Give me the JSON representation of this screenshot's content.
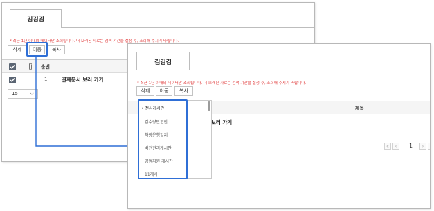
{
  "back_window": {
    "tab_label": "김김김",
    "notice": "* 최근 1년 이내의 데이터만 조회됩니다. 더 오래된 자료는 검색 기간을 설정 후, 조회해 주시기 바랍니다.",
    "buttons": {
      "delete": "삭제",
      "move": "이동",
      "copy": "복사"
    },
    "table": {
      "header_seq": "순번",
      "rows": [
        {
          "seq": "1",
          "title": "결재문서 보러 가기"
        }
      ]
    },
    "page_size": "15"
  },
  "front_window": {
    "tab_label": "김김김",
    "notice": "* 최근 1년 이내의 데이터만 조회됩니다. 더 오래된 자료는 검색 기간을 설정 후, 조회해 주시기 바랍니다.",
    "buttons": {
      "delete": "삭제",
      "move": "이동",
      "copy": "복사"
    },
    "table": {
      "header_title": "제목",
      "row_title": "보러 가기"
    },
    "dropdown": {
      "items": [
        "전사게시판",
        "김수량만권한",
        "차량운행일지",
        "버전관리게시판",
        "영업지원 게시판",
        "11게시"
      ],
      "selected_index": 0
    },
    "pagination": {
      "current_page": "1"
    }
  },
  "colors": {
    "highlight": "#2f6fd6",
    "notice": "#e03a3a",
    "checkbox": "#5b6573"
  },
  "icons": [
    "check-icon",
    "paperclip-icon",
    "chevron-down-icon",
    "arrow-right-icon",
    "first-page-icon",
    "prev-page-icon",
    "next-page-icon",
    "last-page-icon"
  ]
}
